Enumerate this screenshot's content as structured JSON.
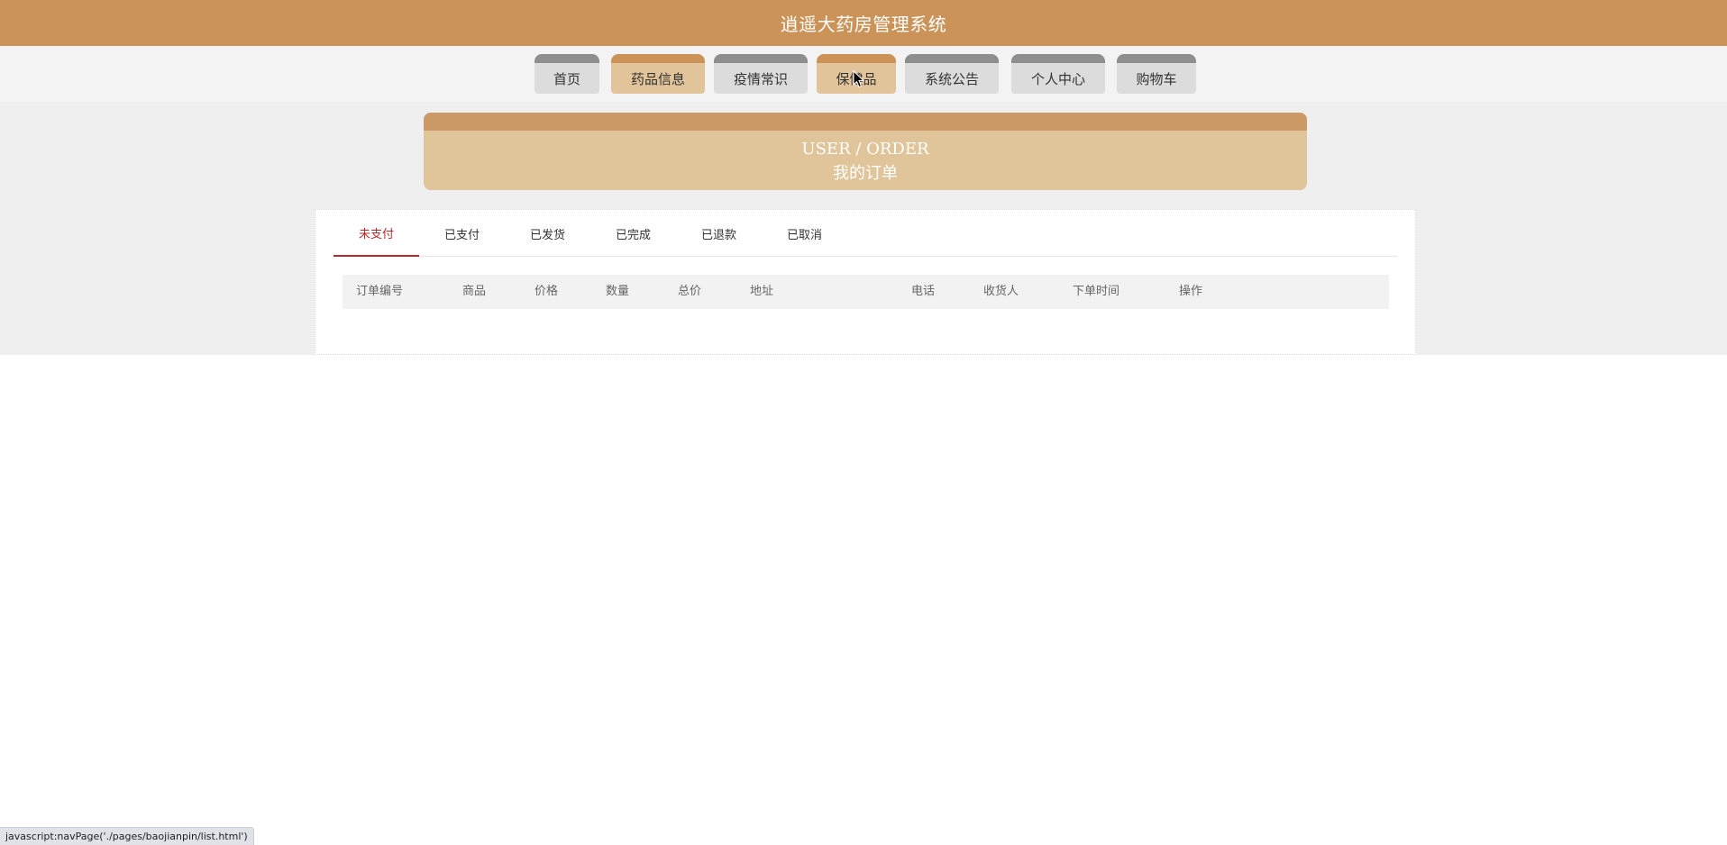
{
  "app": {
    "title": "逍遥大药房管理系统"
  },
  "nav": {
    "items": [
      {
        "label": "首页"
      },
      {
        "label": "药品信息"
      },
      {
        "label": "疫情常识"
      },
      {
        "label": "保健品"
      },
      {
        "label": "系统公告"
      },
      {
        "label": "个人中心"
      },
      {
        "label": "购物车"
      }
    ]
  },
  "banner": {
    "en": "USER / ORDER",
    "zh": "我的订单"
  },
  "tabs": [
    {
      "label": "未支付",
      "active": true
    },
    {
      "label": "已支付"
    },
    {
      "label": "已发货"
    },
    {
      "label": "已完成"
    },
    {
      "label": "已退款"
    },
    {
      "label": "已取消"
    }
  ],
  "table": {
    "columns": [
      "订单编号",
      "商品",
      "价格",
      "数量",
      "总价",
      "地址",
      "电话",
      "收货人",
      "下单时间",
      "操作"
    ],
    "rows": []
  },
  "statusbar": {
    "text": "javascript:navPage('./pages/baojianpin/list.html')"
  },
  "colors": {
    "brand": "#cc9358",
    "banner": "#e0c49a",
    "active_tab": "#b62b2b"
  },
  "icons": {
    "cursor": "mouse-pointer-icon"
  }
}
